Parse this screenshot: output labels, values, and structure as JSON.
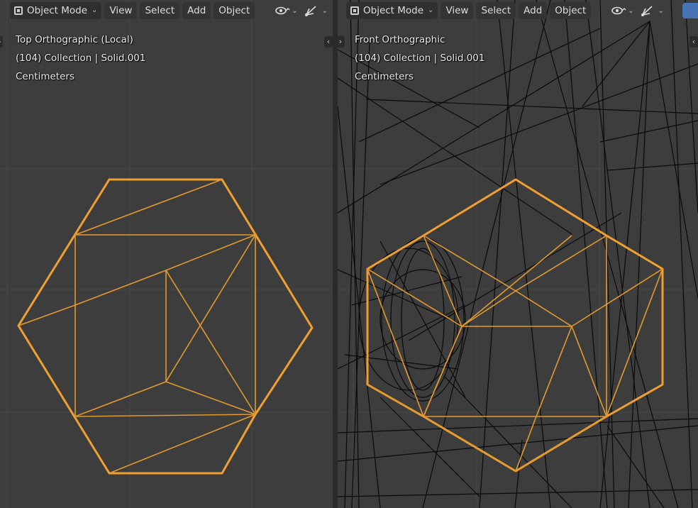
{
  "left_viewport": {
    "header": {
      "mode_label": "Object Mode",
      "menu": [
        "View",
        "Select",
        "Add",
        "Object"
      ]
    },
    "overlay": {
      "view_name": "Top Orthographic (Local)",
      "collection": "(104) Collection | Solid.001",
      "units": "Centimeters"
    }
  },
  "right_viewport": {
    "header": {
      "mode_label": "Object Mode",
      "menu": [
        "View",
        "Select",
        "Add",
        "Object"
      ]
    },
    "overlay": {
      "view_name": "Front Orthographic",
      "collection": "(104) Collection | Solid.001",
      "units": "Centimeters"
    }
  },
  "colors": {
    "viewport_bg": "#3d3d3d",
    "selected_wire": "#f0a030",
    "wire": "#0a0a0a",
    "grid": "#474747"
  },
  "icons": {
    "mode": "object-mode-icon",
    "visibility": "eye-icon",
    "gizmo": "gizmo-icon",
    "collapse_left": "chevron-left-icon",
    "collapse_right": "chevron-right-icon"
  }
}
